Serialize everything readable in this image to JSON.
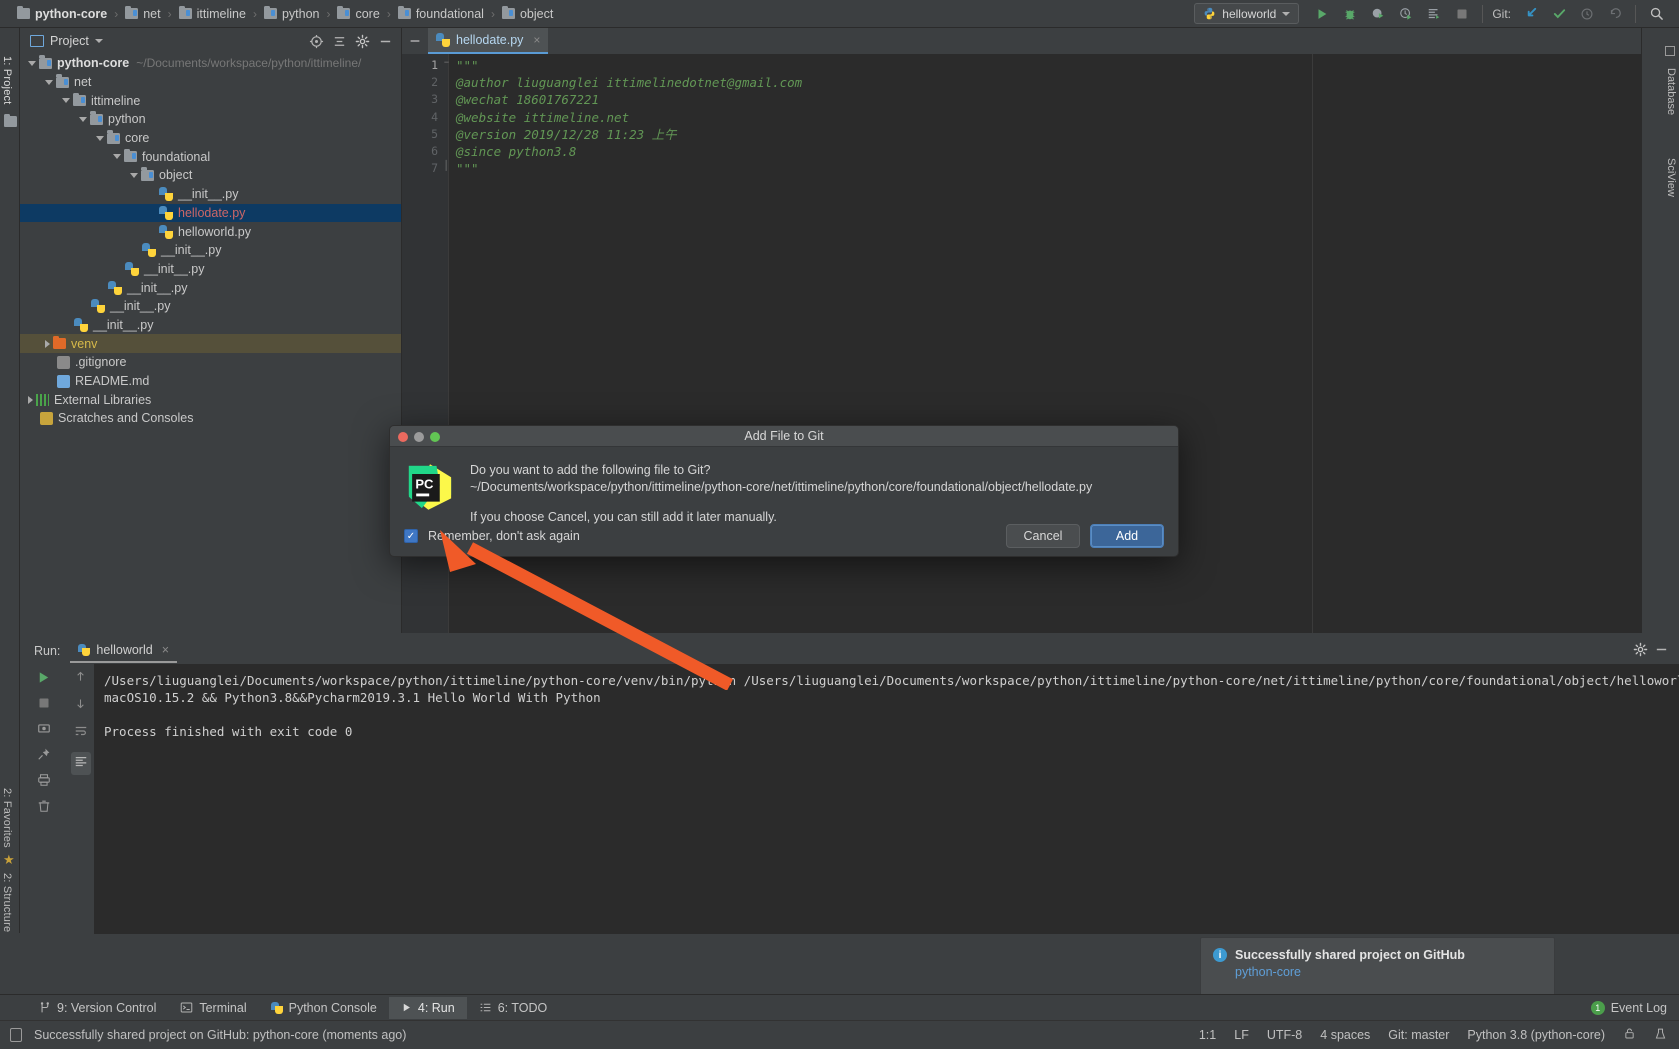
{
  "app": {
    "title": "PyCharm",
    "theme_bg": "#3c3f41",
    "accent": "#3d6ea5"
  },
  "breadcrumb": {
    "items": [
      {
        "label": "python-core",
        "icon": "folder-icon",
        "root": true
      },
      {
        "label": "net",
        "icon": "folder-icon"
      },
      {
        "label": "ittimeline",
        "icon": "folder-icon"
      },
      {
        "label": "python",
        "icon": "folder-icon"
      },
      {
        "label": "core",
        "icon": "folder-icon"
      },
      {
        "label": "foundational",
        "icon": "folder-icon"
      },
      {
        "label": "object",
        "icon": "folder-icon"
      }
    ],
    "separator": "›"
  },
  "toolbar": {
    "run_config": "helloworld",
    "buttons": [
      "run-icon",
      "debug-icon",
      "coverage-icon",
      "profile-icon",
      "run-with-console-icon",
      "stop-icon"
    ],
    "git_label": "Git:",
    "git_buttons": [
      "update-project-icon",
      "commit-icon",
      "history-icon",
      "rollback-icon"
    ],
    "search_label": "search-icon"
  },
  "left_tool_tabs": [
    {
      "label": "1: Project",
      "selected": true
    },
    {
      "label": "2: Favorites",
      "selected": false
    },
    {
      "label": "2: Structure",
      "selected": false
    }
  ],
  "right_tool_tabs": [
    {
      "label": "Database"
    },
    {
      "label": "SciView"
    }
  ],
  "project_panel": {
    "title": "Project",
    "actions": [
      "locate-icon",
      "collapse-all-icon",
      "settings-icon",
      "hide-icon"
    ],
    "tree": [
      {
        "depth": 0,
        "twisty": "down",
        "icon": "folder-icon",
        "label": "python-core",
        "bold": true,
        "path": "~/Documents/workspace/python/ittimeline/"
      },
      {
        "depth": 1,
        "twisty": "down",
        "icon": "folder-icon",
        "label": "net"
      },
      {
        "depth": 2,
        "twisty": "down",
        "icon": "folder-icon",
        "label": "ittimeline"
      },
      {
        "depth": 3,
        "twisty": "down",
        "icon": "folder-icon",
        "label": "python"
      },
      {
        "depth": 4,
        "twisty": "down",
        "icon": "folder-icon",
        "label": "core"
      },
      {
        "depth": 5,
        "twisty": "down",
        "icon": "folder-icon",
        "label": "foundational"
      },
      {
        "depth": 6,
        "twisty": "down",
        "icon": "folder-icon",
        "label": "object"
      },
      {
        "depth": 7,
        "twisty": "none",
        "icon": "python-file-icon",
        "label": "__init__.py"
      },
      {
        "depth": 7,
        "twisty": "none",
        "icon": "python-file-icon",
        "label": "hellodate.py",
        "selected": true,
        "color": "red"
      },
      {
        "depth": 7,
        "twisty": "none",
        "icon": "python-file-icon",
        "label": "helloworld.py"
      },
      {
        "depth": 6,
        "twisty": "none",
        "icon": "python-file-icon",
        "label": "__init__.py"
      },
      {
        "depth": 5,
        "twisty": "none",
        "icon": "python-file-icon",
        "label": "__init__.py"
      },
      {
        "depth": 4,
        "twisty": "none",
        "icon": "python-file-icon",
        "label": "__init__.py"
      },
      {
        "depth": 3,
        "twisty": "none",
        "icon": "python-file-icon",
        "label": "__init__.py"
      },
      {
        "depth": 2,
        "twisty": "none",
        "icon": "python-file-icon",
        "label": "__init__.py"
      },
      {
        "depth": 1,
        "twisty": "right",
        "icon": "folder-orange-icon",
        "label": "venv",
        "highlight": true,
        "color": "venv"
      },
      {
        "depth": 1,
        "twisty": "none",
        "icon": "gitignore-icon",
        "label": ".gitignore"
      },
      {
        "depth": 1,
        "twisty": "none",
        "icon": "markdown-icon",
        "label": "README.md"
      },
      {
        "depth": 0,
        "twisty": "right",
        "icon": "library-icon",
        "label": "External Libraries"
      },
      {
        "depth": 0,
        "twisty": "none",
        "icon": "scratches-icon",
        "label": "Scratches and Consoles"
      }
    ]
  },
  "editor": {
    "tab": {
      "label": "hellodate.py",
      "icon": "python-file-icon",
      "close": "×"
    },
    "lines": [
      {
        "n": "1",
        "text": "\"\"\"",
        "fold": true
      },
      {
        "n": "2",
        "text": "@author liuguanglei ittimelinedotnet@gmail.com"
      },
      {
        "n": "3",
        "text": "@wechat 18601767221"
      },
      {
        "n": "4",
        "text": "@website ittimeline.net"
      },
      {
        "n": "5",
        "text": "@version 2019/12/28 11:23 上午"
      },
      {
        "n": "6",
        "text": "@since python3.8"
      },
      {
        "n": "7",
        "text": "\"\"\"",
        "fold": true
      }
    ],
    "comment_color": "#629755"
  },
  "dialog": {
    "title": "Add File to Git",
    "question": "Do you want to add the following file to Git?",
    "path": "~/Documents/workspace/python/ittimeline/python-core/net/ittimeline/python/core/foundational/object/hellodate.py",
    "note": "If you choose Cancel, you can still add it later manually.",
    "checkbox": {
      "label": "Remember, don't ask again",
      "checked": true,
      "mark": "✓"
    },
    "cancel_label": "Cancel",
    "add_label": "Add",
    "traffic_lights": [
      "close",
      "minimize",
      "zoom"
    ],
    "logo": "pycharm-logo"
  },
  "run_panel": {
    "run_label": "Run:",
    "tab": "helloworld",
    "console_lines": [
      "/Users/liuguanglei/Documents/workspace/python/ittimeline/python-core/venv/bin/python /Users/liuguanglei/Documents/workspace/python/ittimeline/python-core/net/ittimeline/python/core/foundational/object/helloworld.py",
      "macOS10.15.2 && Python3.8&&Pycharm2019.3.1 Hello World With Python",
      "",
      "Process finished with exit code 0"
    ],
    "side_buttons": [
      "rerun-icon",
      "stop-icon",
      "dump-threads-icon",
      "pin-tab-icon",
      "print-icon",
      "trash-icon"
    ],
    "nav_buttons": [
      "up-icon",
      "down-icon",
      "soft-wrap-icon",
      "scroll-to-end-icon"
    ],
    "header_right": [
      "settings-icon",
      "hide-icon"
    ]
  },
  "notification": {
    "icon": "info-icon",
    "title": "Successfully shared project on GitHub",
    "link": "python-core"
  },
  "bottom_tabs": [
    {
      "label": "9: Version Control",
      "icon": "branch-icon",
      "mnemonic": "9",
      "selected": false
    },
    {
      "label": "Terminal",
      "icon": "terminal-icon",
      "selected": false
    },
    {
      "label": "Python Console",
      "icon": "python-icon",
      "selected": false
    },
    {
      "label": "4: Run",
      "icon": "run-icon",
      "mnemonic": "4",
      "selected": true
    },
    {
      "label": "6: TODO",
      "icon": "todo-icon",
      "mnemonic": "6",
      "selected": false
    }
  ],
  "event_log": {
    "label": "Event Log",
    "count": "1"
  },
  "status_bar": {
    "message": "Successfully shared project on GitHub: python-core (moments ago)",
    "items": [
      "1:1",
      "LF",
      "UTF-8",
      "4 spaces",
      "Git: master",
      "Python 3.8 (python-core)"
    ],
    "icons": [
      "lock-icon",
      "inspection-icon"
    ]
  }
}
